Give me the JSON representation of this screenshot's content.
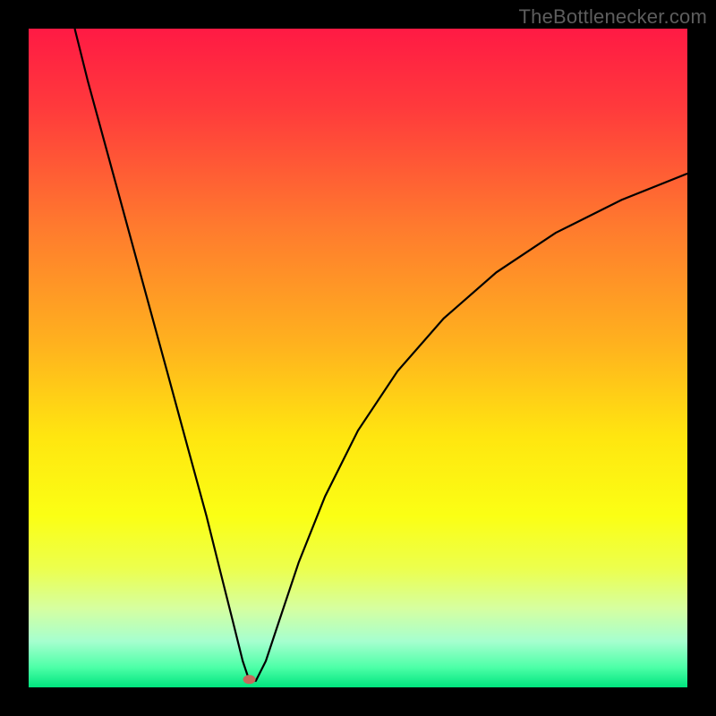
{
  "watermark": "TheBottlenecker.com",
  "chart_data": {
    "type": "line",
    "title": "",
    "xlabel": "",
    "ylabel": "",
    "xlim": [
      0,
      100
    ],
    "ylim": [
      0,
      100
    ],
    "background_gradient": {
      "stops": [
        {
          "offset": 0,
          "color": "#ff1a44"
        },
        {
          "offset": 12,
          "color": "#ff3a3c"
        },
        {
          "offset": 30,
          "color": "#ff7a2e"
        },
        {
          "offset": 48,
          "color": "#ffb21e"
        },
        {
          "offset": 62,
          "color": "#ffe610"
        },
        {
          "offset": 74,
          "color": "#fbff14"
        },
        {
          "offset": 82,
          "color": "#ecff4e"
        },
        {
          "offset": 88,
          "color": "#d6ffa0"
        },
        {
          "offset": 93,
          "color": "#a6ffcf"
        },
        {
          "offset": 97,
          "color": "#4cffa7"
        },
        {
          "offset": 100,
          "color": "#00e47e"
        }
      ]
    },
    "marker": {
      "x": 33.5,
      "y": 1.2,
      "rx": 7,
      "ry": 5,
      "color": "#c56a5c"
    },
    "series": [
      {
        "name": "curve",
        "color": "#000000",
        "width": 2.2,
        "points": [
          {
            "x": 7.0,
            "y": 100.0
          },
          {
            "x": 9.0,
            "y": 92.0
          },
          {
            "x": 12.0,
            "y": 81.0
          },
          {
            "x": 15.0,
            "y": 70.0
          },
          {
            "x": 18.0,
            "y": 59.0
          },
          {
            "x": 21.0,
            "y": 48.0
          },
          {
            "x": 24.0,
            "y": 37.0
          },
          {
            "x": 27.0,
            "y": 26.0
          },
          {
            "x": 29.0,
            "y": 18.0
          },
          {
            "x": 31.0,
            "y": 10.0
          },
          {
            "x": 32.5,
            "y": 4.0
          },
          {
            "x": 33.5,
            "y": 1.0
          },
          {
            "x": 34.5,
            "y": 1.0
          },
          {
            "x": 36.0,
            "y": 4.0
          },
          {
            "x": 38.0,
            "y": 10.0
          },
          {
            "x": 41.0,
            "y": 19.0
          },
          {
            "x": 45.0,
            "y": 29.0
          },
          {
            "x": 50.0,
            "y": 39.0
          },
          {
            "x": 56.0,
            "y": 48.0
          },
          {
            "x": 63.0,
            "y": 56.0
          },
          {
            "x": 71.0,
            "y": 63.0
          },
          {
            "x": 80.0,
            "y": 69.0
          },
          {
            "x": 90.0,
            "y": 74.0
          },
          {
            "x": 100.0,
            "y": 78.0
          }
        ]
      }
    ]
  }
}
